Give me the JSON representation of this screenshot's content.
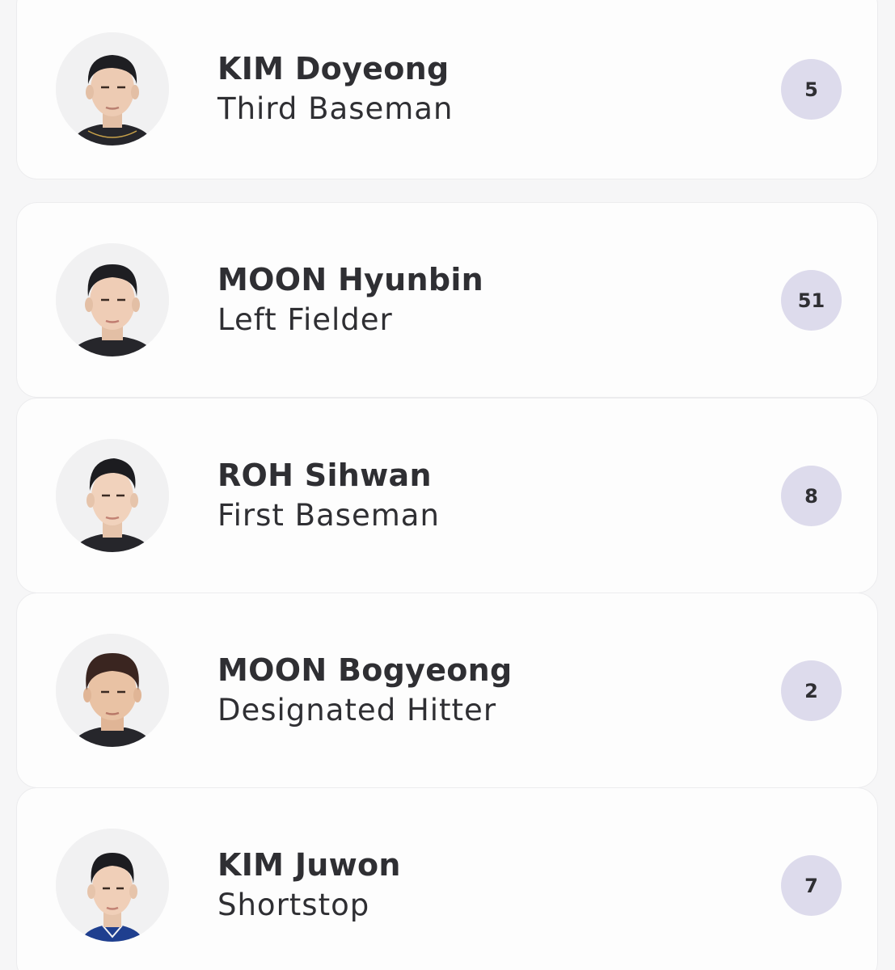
{
  "colors": {
    "background": "#f6f6f7",
    "card": "#fdfdfd",
    "text": "#2f2f33",
    "number_badge": "#dddbec"
  },
  "players": [
    {
      "name": "KIM Doyeong",
      "position": "Third Baseman",
      "number": "5",
      "avatar_icon": "player-photo-icon"
    },
    {
      "name": "MOON Hyunbin",
      "position": "Left Fielder",
      "number": "51",
      "avatar_icon": "player-photo-icon"
    },
    {
      "name": "ROH Sihwan",
      "position": "First Baseman",
      "number": "8",
      "avatar_icon": "player-photo-icon"
    },
    {
      "name": "MOON Bogyeong",
      "position": "Designated Hitter",
      "number": "2",
      "avatar_icon": "player-photo-icon"
    },
    {
      "name": "KIM Juwon",
      "position": "Shortstop",
      "number": "7",
      "avatar_icon": "player-photo-icon"
    }
  ]
}
